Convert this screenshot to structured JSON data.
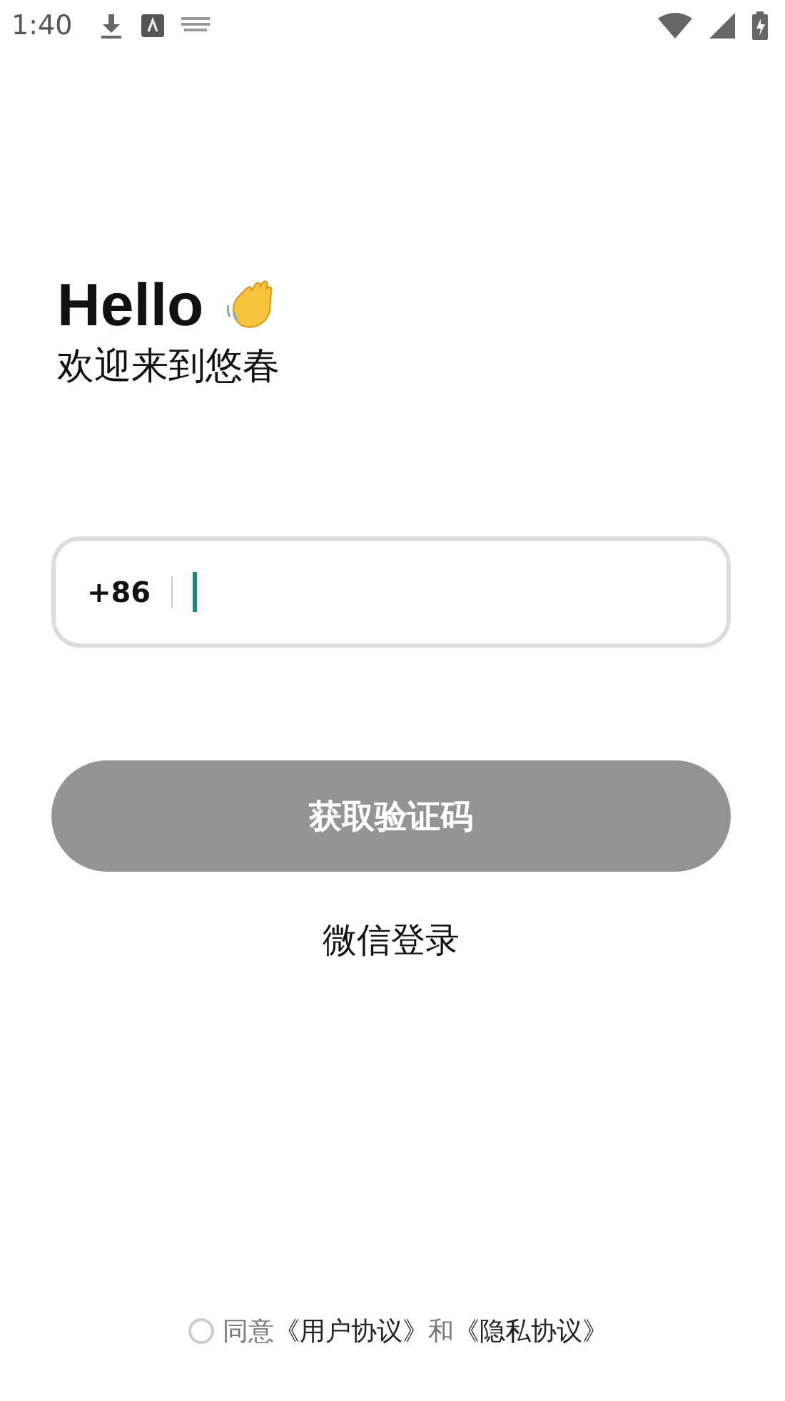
{
  "status_bar": {
    "time": "1:40"
  },
  "greeting": {
    "title": "Hello",
    "subtitle": "欢迎来到悠春"
  },
  "phone_field": {
    "country_code": "+86",
    "focused": true
  },
  "primary_button": {
    "label": "获取验证码",
    "disabled": true
  },
  "secondary_link": {
    "label": "微信登录"
  },
  "agreement": {
    "checked": false,
    "parts": [
      {
        "kind": "text",
        "text": "同意"
      },
      {
        "kind": "link",
        "text": "《用户协议》"
      },
      {
        "kind": "text",
        "text": "和"
      },
      {
        "kind": "link",
        "text": "《隐私协议》"
      }
    ]
  }
}
